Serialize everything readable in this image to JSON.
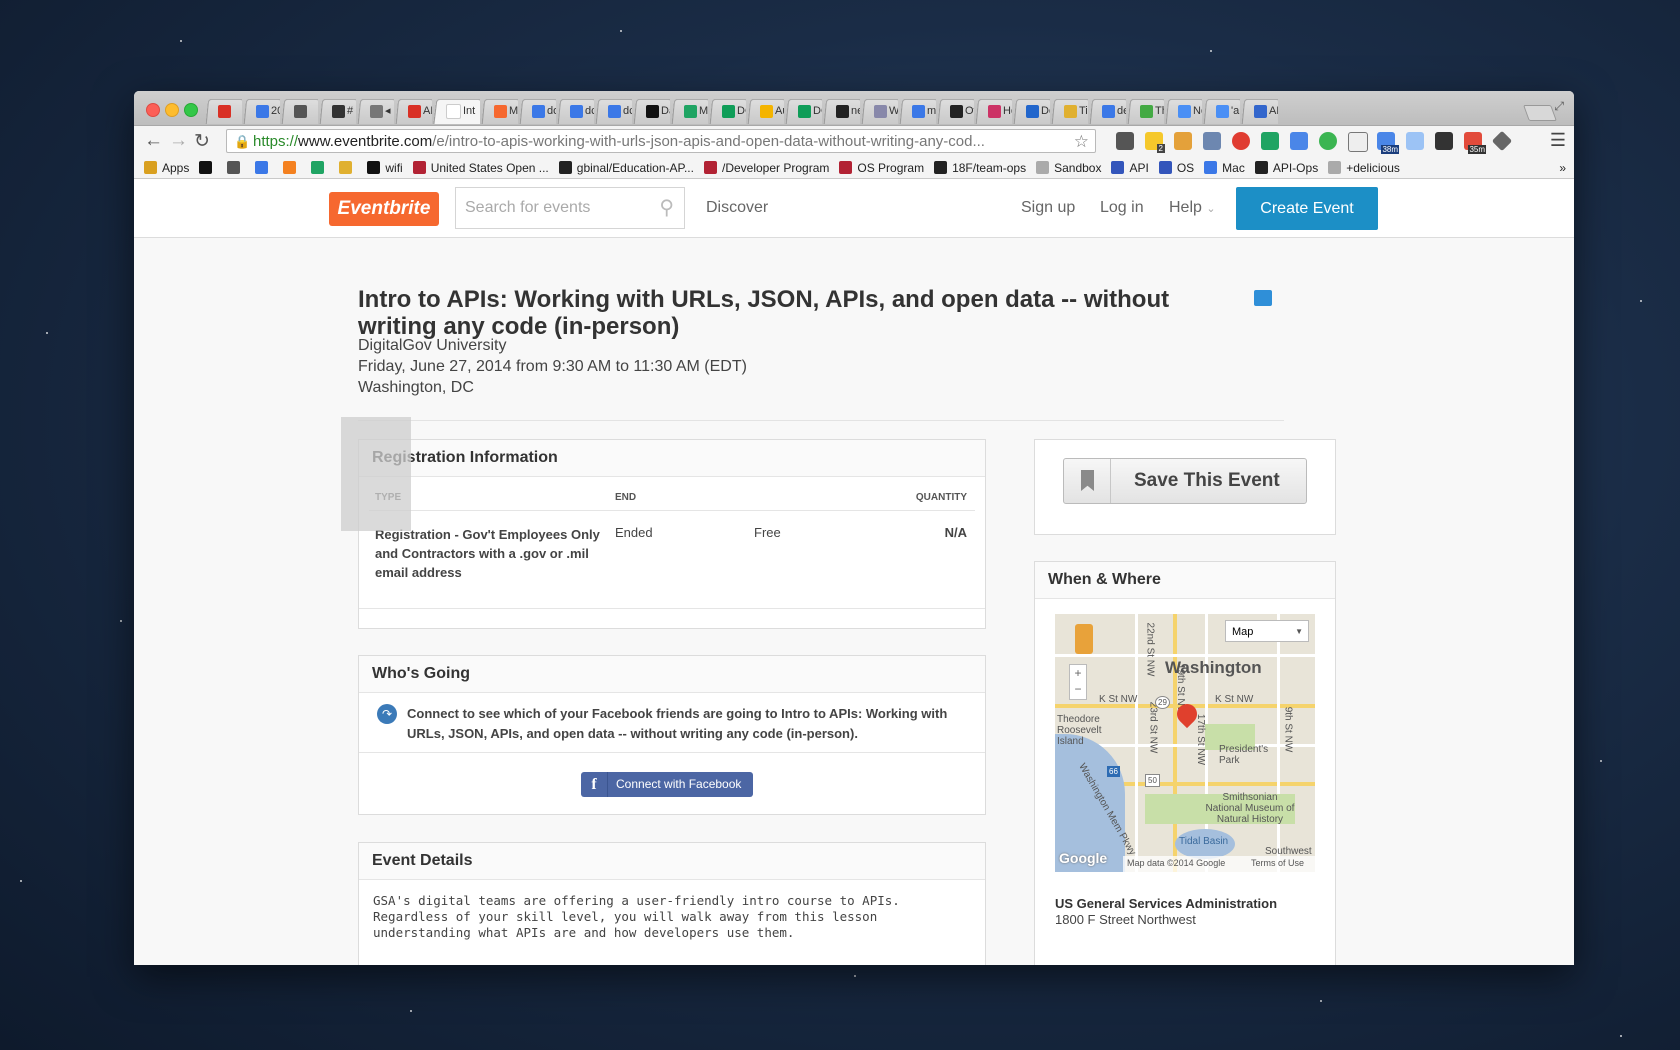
{
  "browser": {
    "tabs": [
      {
        "label": "",
        "color": "#d93025"
      },
      {
        "label": "20",
        "color": "#3b78e7"
      },
      {
        "label": "",
        "color": "#555555"
      },
      {
        "label": "#",
        "color": "#333333"
      },
      {
        "label": "◂",
        "color": "#777777"
      },
      {
        "label": "AF",
        "color": "#d93025"
      },
      {
        "label": "Int",
        "color": "#ffffff"
      },
      {
        "label": "Mc",
        "color": "#f6682f"
      },
      {
        "label": "do",
        "color": "#3b78e7"
      },
      {
        "label": "dc",
        "color": "#3b78e7"
      },
      {
        "label": "dc",
        "color": "#3b78e7"
      },
      {
        "label": "Da",
        "color": "#111111"
      },
      {
        "label": "My",
        "color": "#1fa463"
      },
      {
        "label": "DC",
        "color": "#0f9d58"
      },
      {
        "label": "Au",
        "color": "#f4b400"
      },
      {
        "label": "DC",
        "color": "#0f9d58"
      },
      {
        "label": "ne",
        "color": "#222222"
      },
      {
        "label": "Wh",
        "color": "#8888aa"
      },
      {
        "label": "ma",
        "color": "#3b78e7"
      },
      {
        "label": "Ov",
        "color": "#222222"
      },
      {
        "label": "Ho",
        "color": "#cc3366"
      },
      {
        "label": "De",
        "color": "#2266cc"
      },
      {
        "label": "Tir",
        "color": "#e0b030"
      },
      {
        "label": "de",
        "color": "#3b78e7"
      },
      {
        "label": "Th",
        "color": "#44aa44"
      },
      {
        "label": "Ne",
        "color": "#4a8ff5"
      },
      {
        "label": "'ap",
        "color": "#4a8ff5"
      },
      {
        "label": "AP",
        "color": "#3366cc"
      }
    ],
    "url": {
      "scheme": "https://",
      "host": "www.eventbrite.com",
      "path": "/e/intro-to-apis-working-with-urls-json-apis-and-open-data-without-writing-any-cod..."
    },
    "ext_badges": {
      "b1": "2",
      "b2": "38m",
      "b3": "35m"
    },
    "bookmarks": [
      {
        "label": "Apps",
        "color": "#d9a020"
      },
      {
        "label": "",
        "color": "#111111"
      },
      {
        "label": "",
        "color": "#555555"
      },
      {
        "label": "",
        "color": "#3b78e7"
      },
      {
        "label": "",
        "color": "#f48120"
      },
      {
        "label": "",
        "color": "#1fa463"
      },
      {
        "label": "",
        "color": "#e0b030"
      },
      {
        "label": "wifi",
        "color": "#111111"
      },
      {
        "label": "United States Open ...",
        "color": "#b22234"
      },
      {
        "label": "gbinal/Education-AP...",
        "color": "#222222"
      },
      {
        "label": "/Developer Program",
        "color": "#b22234"
      },
      {
        "label": "OS Program",
        "color": "#b22234"
      },
      {
        "label": "18F/team-ops",
        "color": "#222222"
      },
      {
        "label": "Sandbox",
        "color": "#aaaaaa"
      },
      {
        "label": "API",
        "color": "#3355bb"
      },
      {
        "label": "OS",
        "color": "#3355bb"
      },
      {
        "label": "Mac",
        "color": "#3b78e7"
      },
      {
        "label": "API-Ops",
        "color": "#222222"
      },
      {
        "label": "+delicious",
        "color": "#aaaaaa"
      }
    ],
    "bookmarks_overflow": "»"
  },
  "header": {
    "logo": "Eventbrite",
    "search_placeholder": "Search for events",
    "discover": "Discover",
    "signup": "Sign up",
    "login": "Log in",
    "help": "Help",
    "create_event": "Create Event"
  },
  "event": {
    "title": "Intro to APIs: Working with URLs, JSON, APIs, and open data -- without writing any code (in-person)",
    "organizer": "DigitalGov University",
    "datetime": "Friday, June 27, 2014 from 9:30 AM to 11:30 AM (EDT)",
    "location": "Washington, DC"
  },
  "registration": {
    "heading": "Registration Information",
    "columns": {
      "type": "TYPE",
      "end": "END",
      "quantity": "QUANTITY"
    },
    "row": {
      "type": "Registration - Gov't Employees Only and Contractors with a .gov or .mil email address",
      "end": "Ended",
      "price": "Free",
      "quantity": "N/A"
    }
  },
  "whos_going": {
    "heading": "Who's Going",
    "message": "Connect to see which of your Facebook friends are going to Intro to APIs: Working with URLs, JSON, APIs, and open data -- without writing any code (in-person).",
    "button": "Connect with Facebook"
  },
  "details": {
    "heading": "Event Details",
    "text": "GSA's digital teams are offering a user-friendly intro course to APIs. Regardless of your skill level, you will walk away from this lesson understanding what APIs are and how developers use them."
  },
  "save": {
    "label": "Save This Event"
  },
  "when_where": {
    "heading": "When & Where",
    "map": {
      "type_select": "Map",
      "city": "Washington",
      "labels": [
        "K St NW",
        "K St NW",
        "President's Park",
        "Smithsonian National Museum of Natural History",
        "Tidal Basin",
        "23rd St NW",
        "22nd St NW",
        "17th St NW",
        "9th St NW",
        "19th St NW",
        "Theodore Roosevelt Island",
        "Washington Mem Pkwy",
        "Southwest"
      ],
      "shields": [
        "29",
        "66",
        "50"
      ],
      "attribution": "Map data ©2014 Google",
      "terms": "Terms of Use",
      "google": "Google"
    },
    "venue": "US General Services Administration",
    "address": "1800 F Street Northwest"
  }
}
